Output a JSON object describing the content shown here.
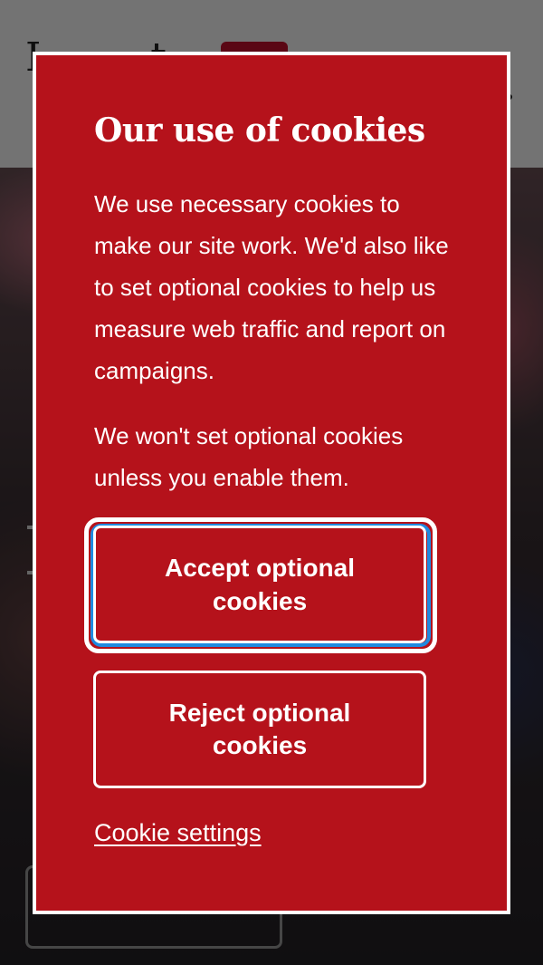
{
  "modal": {
    "title": "Our use of cookies",
    "paragraph_1": "We use necessary cookies to make our site work. We'd also like to set optional cookies to help us measure web traffic and report on campaigns.",
    "paragraph_2": "We won't set optional cookies unless you enable them.",
    "accept_label": "Accept optional cookies",
    "reject_label": "Reject optional cookies",
    "settings_link": "Cookie settings"
  },
  "colors": {
    "modal_background": "#b5121b",
    "focus_ring": "#1f8ae0",
    "text": "#ffffff"
  }
}
